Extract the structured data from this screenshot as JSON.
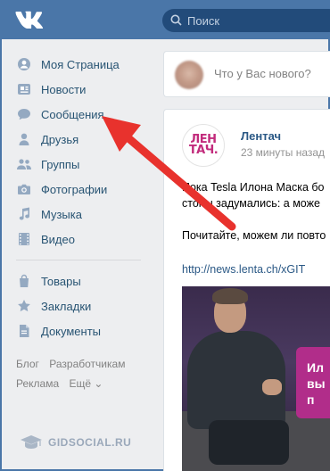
{
  "header": {
    "logo_text": "VK",
    "search_placeholder": "Поиск",
    "accent": "#4a76a8"
  },
  "sidebar": {
    "items": [
      {
        "label": "Моя Страница",
        "icon": "home-icon"
      },
      {
        "label": "Новости",
        "icon": "news-icon"
      },
      {
        "label": "Сообщения",
        "icon": "chat-icon"
      },
      {
        "label": "Друзья",
        "icon": "person-icon"
      },
      {
        "label": "Группы",
        "icon": "group-icon"
      },
      {
        "label": "Фотографии",
        "icon": "camera-icon"
      },
      {
        "label": "Музыка",
        "icon": "music-icon"
      },
      {
        "label": "Видео",
        "icon": "film-icon"
      }
    ],
    "items2": [
      {
        "label": "Товары",
        "icon": "bag-icon"
      },
      {
        "label": "Закладки",
        "icon": "star-icon"
      },
      {
        "label": "Документы",
        "icon": "doc-icon"
      }
    ],
    "links": {
      "blog": "Блог",
      "dev": "Разработчикам",
      "ads": "Реклама",
      "more": "Ещё ⌄"
    },
    "watermark": "GIDSOCIAL.RU"
  },
  "composer": {
    "placeholder": "Что у Вас нового?"
  },
  "post": {
    "author": "Лентач",
    "time": "23 минуты назад",
    "logo_text": "ЛЕН\nТАЧ.",
    "line1": "Пока Tesla Илона Маска бо",
    "line2": "стоны задумались: а може",
    "line3": "Почитайте, можем ли повто",
    "link": "http://news.lenta.ch/xGIT",
    "image_caption_line1": "Ил",
    "image_caption_line2": "вы п"
  }
}
